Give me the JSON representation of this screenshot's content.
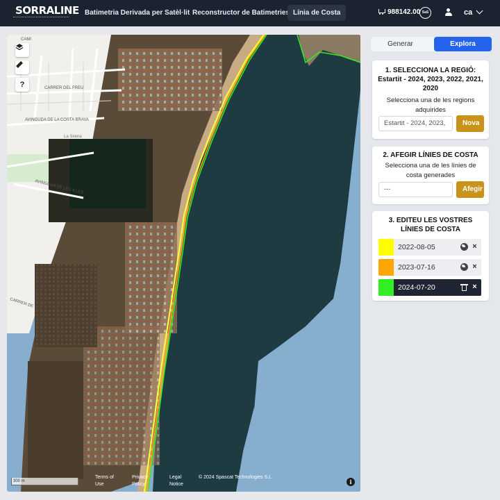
{
  "navbar": {
    "logo": "SORRALINE",
    "links": [
      {
        "label": "Batimetria Derivada per Satèl·lit"
      },
      {
        "label": "Reconstructor de Batimetries"
      },
      {
        "label": "Línia de Costa",
        "active": true
      }
    ],
    "credits": "988142.00",
    "coin_label": "SaS",
    "language": "ca",
    "icons": {
      "cart": "cart-icon",
      "coin": "coin-icon",
      "user": "user-icon",
      "dropdown": "chevron-down-icon"
    }
  },
  "map": {
    "controls": [
      {
        "name": "layers-button",
        "icon": "layers-icon"
      },
      {
        "name": "ruler-button",
        "icon": "ruler-icon"
      },
      {
        "name": "help-button",
        "label": "?"
      }
    ],
    "street_labels": {
      "frau": "CARRER DEL FREU",
      "costa_brava": "AVINGUDA DE LA COSTA BRAVA",
      "sirena": "La Sirena",
      "illes": "AVINGUDA DE LES ILLES",
      "carrer": "CARRER DE",
      "cami": "CAMI"
    },
    "scale": "300 m",
    "attribution": {
      "terms": "Terms of Use",
      "privacy": "Privacy Policy",
      "legal": "Legal Notice",
      "copyright": "© 2024 Spascat Technologies S.L."
    },
    "colors": {
      "sea": "#1d3b40",
      "sea_light": "#87aecf",
      "sand": "#c9ad86",
      "land": "#5a4a38"
    }
  },
  "sidebar": {
    "tabs": [
      {
        "label": "Generar"
      },
      {
        "label": "Explora",
        "active": true
      }
    ],
    "step1": {
      "title": "1. SELECCIONA LA REGIÓ: Estartit - 2024, 2023, 2022, 2021, 2020",
      "description": "Selecciona una de les regions adquirides",
      "value": "Estartit - 2024, 2023,",
      "button": "Nova"
    },
    "step2": {
      "title": "2. AFEGIR LÍNIES DE COSTA",
      "description": "Selecciona una de les línies de costa generades",
      "value": "---",
      "button": "Afegir"
    },
    "step3": {
      "title": "3. EDITEU LES VOSTRES LÍNIES DE COSTA",
      "lines": [
        {
          "date": "2022-08-05",
          "color": "#ffff00",
          "icon": "globe-icon"
        },
        {
          "date": "2023-07-16",
          "color": "#ffa500",
          "icon": "globe-icon"
        },
        {
          "date": "2024-07-20",
          "color": "#33ee22",
          "icon": "trash-icon",
          "selected": true
        }
      ]
    },
    "colors": {
      "accent": "#2563eb",
      "gold": "#c9921a"
    }
  }
}
